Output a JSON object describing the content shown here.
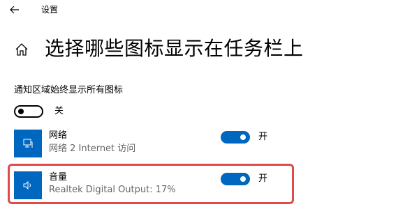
{
  "window": {
    "title": "设置",
    "back_icon": "back-arrow-icon"
  },
  "page": {
    "title": "选择哪些图标显示在任务栏上",
    "home_icon": "home-icon"
  },
  "always_show": {
    "label": "通知区域始终显示所有图标",
    "state": "off",
    "state_label": "关"
  },
  "apps": [
    {
      "name": "网络",
      "subtitle": "网络 2 Internet 访问",
      "icon": "network-icon",
      "state": "on",
      "state_label": "开"
    },
    {
      "name": "音量",
      "subtitle": "Realtek Digital Output: 17%",
      "icon": "volume-icon",
      "state": "on",
      "state_label": "开",
      "highlighted": true
    }
  ],
  "colors": {
    "accent": "#0067c0",
    "highlight": "#e04a4a"
  }
}
